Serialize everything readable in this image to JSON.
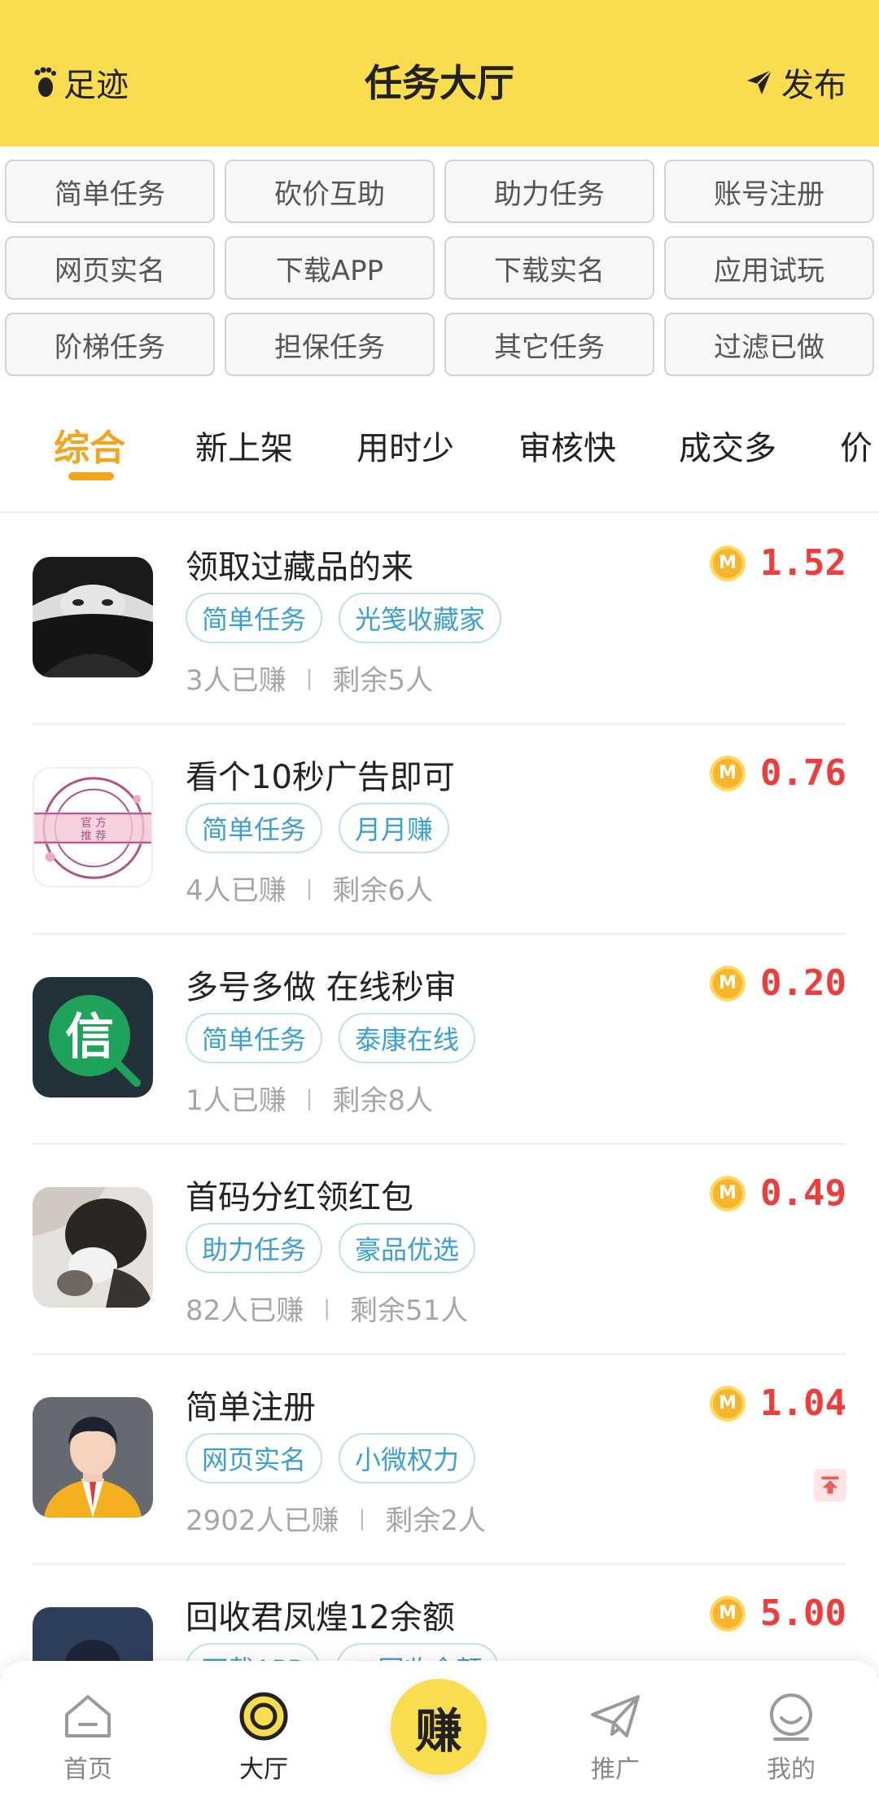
{
  "header": {
    "left_label": "足迹",
    "title": "任务大厅",
    "right_label": "发布"
  },
  "categories": [
    "简单任务",
    "砍价互助",
    "助力任务",
    "账号注册",
    "网页实名",
    "下载APP",
    "下载实名",
    "应用试玩",
    "阶梯任务",
    "担保任务",
    "其它任务",
    "过滤已做"
  ],
  "sort_tabs": [
    "综合",
    "新上架",
    "用时少",
    "审核快",
    "成交多",
    "价"
  ],
  "tasks": [
    {
      "title": "领取过藏品的来",
      "tags": [
        "简单任务",
        "光笺收藏家"
      ],
      "earned": "3人已赚",
      "remaining": "剩余5人",
      "price": "1.52",
      "avatar": "portrait-girl"
    },
    {
      "title": "看个10秒广告即可",
      "tags": [
        "简单任务",
        "月月赚"
      ],
      "earned": "4人已赚",
      "remaining": "剩余6人",
      "price": "0.76",
      "avatar": "stamp"
    },
    {
      "title": "多号多做 在线秒审",
      "tags": [
        "简单任务",
        "泰康在线"
      ],
      "earned": "1人已赚",
      "remaining": "剩余8人",
      "price": "0.20",
      "avatar": "xin"
    },
    {
      "title": "首码分红领红包",
      "tags": [
        "助力任务",
        "豪品优选"
      ],
      "earned": "82人已赚",
      "remaining": "剩余51人",
      "price": "0.49",
      "avatar": "cat"
    },
    {
      "title": "简单注册",
      "tags": [
        "网页实名",
        "小微权力"
      ],
      "earned": "2902人已赚",
      "remaining": "剩余2人",
      "price": "1.04",
      "avatar": "man"
    },
    {
      "title": "回收君凤煌12余额",
      "tags": [
        "下载APP",
        "二回收余额"
      ],
      "earned": "",
      "remaining": "",
      "price": "5.00",
      "avatar": "dark"
    }
  ],
  "coin_letter": "M",
  "separator": "|",
  "stamp_text": [
    "官 方",
    "推 荐"
  ],
  "xin_char": "信",
  "nav": {
    "home": "首页",
    "hall": "大厅",
    "earn": "赚",
    "promote": "推广",
    "mine": "我的"
  },
  "colors": {
    "header_bg": "#f9dd4f",
    "active_tab": "#f2a51f",
    "price": "#ef3d3d",
    "tag": "#3a9fd6"
  }
}
